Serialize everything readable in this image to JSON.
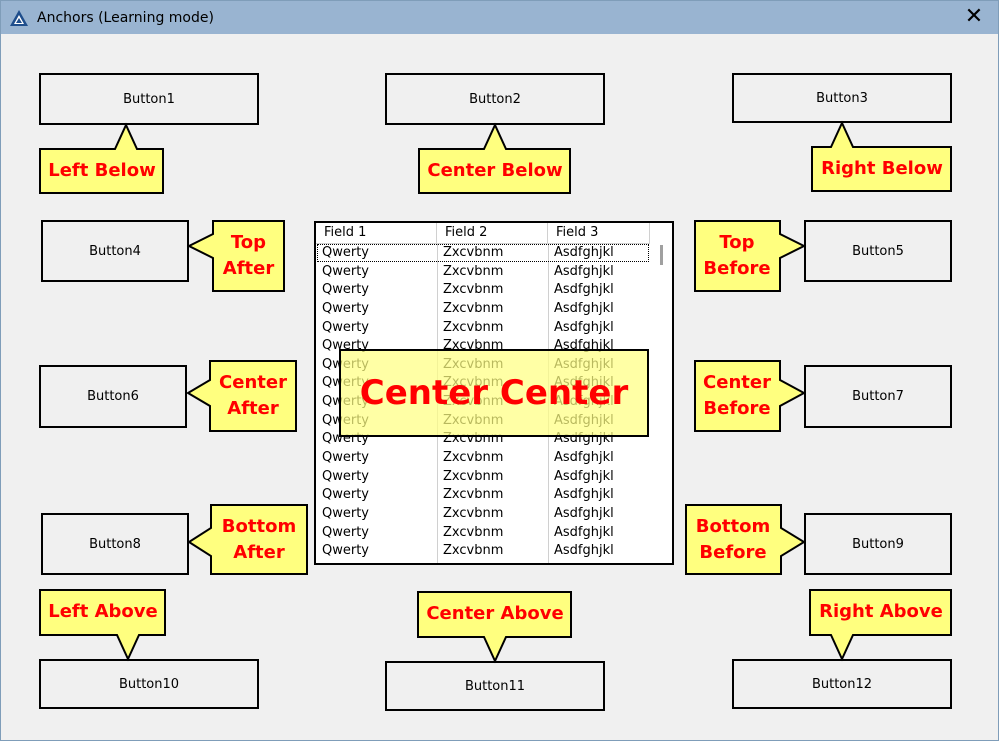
{
  "window": {
    "title": "Anchors (Learning mode)",
    "close_glyph": "✕",
    "icon": "app-logo-icon"
  },
  "buttons": {
    "b1": "Button1",
    "b2": "Button2",
    "b3": "Button3",
    "b4": "Button4",
    "b5": "Button5",
    "b6": "Button6",
    "b7": "Button7",
    "b8": "Button8",
    "b9": "Button9",
    "b10": "Button10",
    "b11": "Button11",
    "b12": "Button12"
  },
  "callouts": {
    "left_below": "Left Below",
    "center_below": "Center Below",
    "right_below": "Right Below",
    "top_after": "Top After",
    "top_before": "Top Before",
    "center_after": "Center After",
    "center_before": "Center Before",
    "bottom_after": "Bottom After",
    "bottom_before": "Bottom Before",
    "left_above": "Left Above",
    "center_above": "Center Above",
    "right_above": "Right Above",
    "center_center": "Center Center"
  },
  "grid": {
    "columns": [
      "Field 1",
      "Field 2",
      "Field 3"
    ],
    "rows": [
      [
        "Qwerty",
        "Zxcvbnm",
        "Asdfghjkl"
      ],
      [
        "Qwerty",
        "Zxcvbnm",
        "Asdfghjkl"
      ],
      [
        "Qwerty",
        "Zxcvbnm",
        "Asdfghjkl"
      ],
      [
        "Qwerty",
        "Zxcvbnm",
        "Asdfghjkl"
      ],
      [
        "Qwerty",
        "Zxcvbnm",
        "Asdfghjkl"
      ],
      [
        "Qwerty",
        "Zxcvbnm",
        "Asdfghjkl"
      ],
      [
        "Qwerty",
        "Zxcvbnm",
        "Asdfghjkl"
      ],
      [
        "Qwerty",
        "Zxcvbnm",
        "Asdfghjkl"
      ],
      [
        "Qwerty",
        "Zxcvbnm",
        "Asdfghjkl"
      ],
      [
        "Qwerty",
        "Zxcvbnm",
        "Asdfghjkl"
      ],
      [
        "Qwerty",
        "Zxcvbnm",
        "Asdfghjkl"
      ],
      [
        "Qwerty",
        "Zxcvbnm",
        "Asdfghjkl"
      ],
      [
        "Qwerty",
        "Zxcvbnm",
        "Asdfghjkl"
      ],
      [
        "Qwerty",
        "Zxcvbnm",
        "Asdfghjkl"
      ],
      [
        "Qwerty",
        "Zxcvbnm",
        "Asdfghjkl"
      ],
      [
        "Qwerty",
        "Zxcvbnm",
        "Asdfghjkl"
      ],
      [
        "Qwerty",
        "Zxcvbnm",
        "Asdfghjkl"
      ]
    ]
  },
  "colors": {
    "callout_fill": "#ffff7f",
    "callout_text": "#ff0000",
    "titlebar": "#99b4d1",
    "window_bg": "#f0f0f0"
  }
}
